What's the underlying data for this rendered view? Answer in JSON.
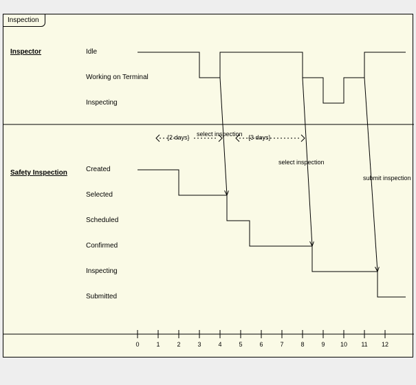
{
  "title": "Inspection",
  "swimlanes": {
    "inspector": {
      "label": "Inspector",
      "states": [
        "Idle",
        "Working on Terminal",
        "Inspecting"
      ]
    },
    "safety": {
      "label": "Safety Inspection",
      "states": [
        "Created",
        "Selected",
        "Scheduled",
        "Confirmed",
        "Inspecting",
        "Submitted"
      ]
    }
  },
  "timeline": {
    "ticks": [
      "0",
      "1",
      "2",
      "3",
      "4",
      "5",
      "6",
      "7",
      "8",
      "9",
      "10",
      "11",
      "12"
    ]
  },
  "constraints": {
    "c1": "{2 days}",
    "c2": "{3 days}"
  },
  "messages": {
    "m1": "select inspection",
    "m2": "select inspection",
    "m3": "submit inspection"
  },
  "chart_data": {
    "type": "timing-diagram",
    "title": "Inspection",
    "x": [
      0,
      1,
      2,
      3,
      4,
      5,
      6,
      7,
      8,
      9,
      10,
      11,
      12
    ],
    "xlabel": "",
    "lifelines": [
      {
        "name": "Inspector",
        "states": [
          "Idle",
          "Working on Terminal",
          "Inspecting"
        ],
        "segments": [
          {
            "from": 0,
            "to": 3,
            "state": "Idle"
          },
          {
            "from": 3,
            "to": 4,
            "state": "Working on Terminal"
          },
          {
            "from": 4,
            "to": 8,
            "state": "Idle"
          },
          {
            "from": 8,
            "to": 9,
            "state": "Working on Terminal"
          },
          {
            "from": 9,
            "to": 10,
            "state": "Inspecting"
          },
          {
            "from": 10,
            "to": 11,
            "state": "Working on Terminal"
          },
          {
            "from": 11,
            "to": 12,
            "state": "Idle"
          }
        ]
      },
      {
        "name": "Safety Inspection",
        "states": [
          "Created",
          "Selected",
          "Scheduled",
          "Confirmed",
          "Inspecting",
          "Submitted"
        ],
        "segments": [
          {
            "from": 0,
            "to": 2,
            "state": "Created"
          },
          {
            "from": 2,
            "to": 4,
            "state": "Selected"
          },
          {
            "from": 4,
            "to": 5,
            "state": "Scheduled"
          },
          {
            "from": 5,
            "to": 8,
            "state": "Confirmed"
          },
          {
            "from": 8,
            "to": 9,
            "state": "Inspecting"
          },
          {
            "from": 9,
            "to": 11,
            "state": "Inspecting"
          },
          {
            "from": 11,
            "to": 12,
            "state": "Submitted"
          }
        ]
      }
    ],
    "messages": [
      {
        "label": "select inspection",
        "from_lifeline": "Inspector",
        "to_lifeline": "Safety Inspection",
        "at": 4
      },
      {
        "label": "select inspection",
        "from_lifeline": "Inspector",
        "to_lifeline": "Safety Inspection",
        "at": 8
      },
      {
        "label": "submit inspection",
        "from_lifeline": "Inspector",
        "to_lifeline": "Safety Inspection",
        "at": 11
      }
    ],
    "duration_constraints": [
      {
        "label": "{2 days}",
        "from": 2,
        "to": 4
      },
      {
        "label": "{3 days}",
        "from": 5,
        "to": 8
      }
    ]
  }
}
